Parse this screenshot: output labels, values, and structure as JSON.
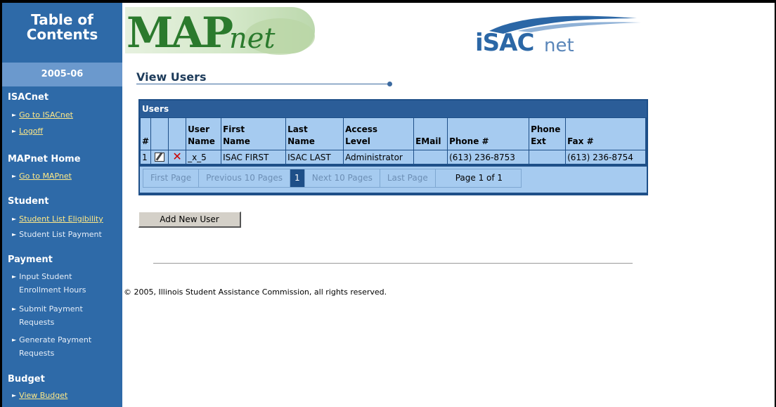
{
  "sidebar": {
    "toc_line1": "Table of",
    "toc_line2": "Contents",
    "year": "2005-06",
    "sections": {
      "isacnet": {
        "title": "ISACnet",
        "links": [
          "Go to ISACnet",
          "Logoff"
        ]
      },
      "mapnet_home": {
        "title": "MAPnet Home",
        "links": [
          "Go to MAPnet"
        ]
      },
      "student": {
        "title": "Student",
        "links": [
          "Student List Eligibility",
          "Student List Payment"
        ]
      },
      "payment": {
        "title": "Payment",
        "links": [
          {
            "line1": "Input Student",
            "line2": "Enrollment Hours"
          },
          {
            "line1": "Submit Payment",
            "line2": "Requests"
          },
          {
            "line1": "Generate Payment",
            "line2": "Requests"
          }
        ]
      },
      "budget": {
        "title": "Budget",
        "links": [
          "View Budget"
        ]
      }
    }
  },
  "header": {
    "map_logo_main": "MAP",
    "map_logo_sub": "net",
    "isac_logo_main": "iSAC",
    "isac_logo_sub": "net"
  },
  "main": {
    "page_title": "View Users",
    "users_table": {
      "title": "Users",
      "columns": [
        "#",
        "",
        "",
        "User Name",
        "First Name",
        "Last Name",
        "Access Level",
        "EMail",
        "Phone #",
        "Phone Ext",
        "Fax #"
      ],
      "rows": [
        {
          "num": "1",
          "user_name": "_x_5",
          "first_name": "ISAC FIRST",
          "last_name": "ISAC LAST",
          "access_level": "Administrator",
          "email": "",
          "phone": "(613) 236-8753",
          "phone_ext": "",
          "fax": "(613) 236-8754"
        }
      ],
      "pager": {
        "first": "First Page",
        "prev10": "Previous 10 Pages",
        "current": "1",
        "next10": "Next 10 Pages",
        "last": "Last Page",
        "info": "Page 1 of 1"
      }
    },
    "add_button": "Add New User",
    "footer": "© 2005, Illinois Student Assistance Commission, all rights reserved."
  },
  "icons": {
    "edit": "edit-icon",
    "delete": "delete-icon",
    "arrow": "triangle-right-icon"
  },
  "colors": {
    "sidebar": "#2e6aa8",
    "table_header": "#2b5d98",
    "table_bg": "#a6cbf0",
    "link": "#ffe987"
  }
}
